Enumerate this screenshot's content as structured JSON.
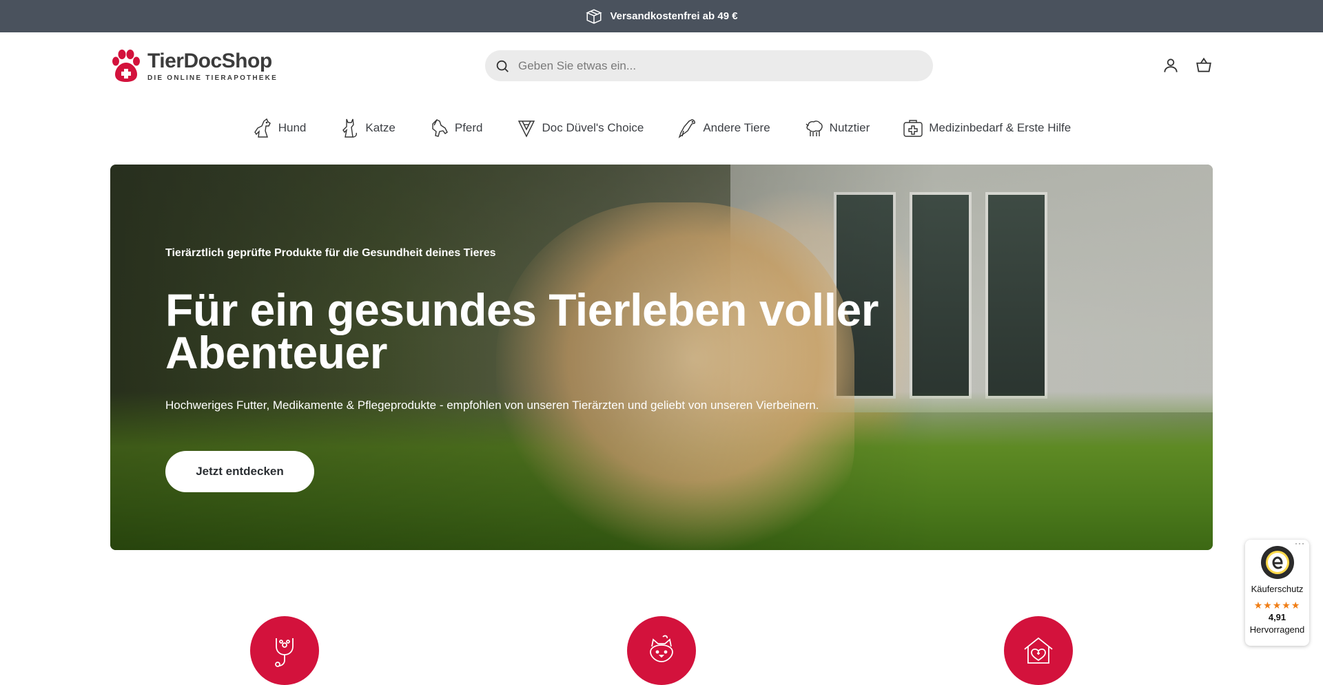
{
  "announcement": {
    "text": "Versandkostenfrei ab 49 €"
  },
  "header": {
    "logo_name": "TierDocShop",
    "logo_tagline": "DIE ONLINE TIERAPOTHEKE",
    "search_placeholder": "Geben Sie etwas ein..."
  },
  "nav": {
    "items": [
      {
        "label": "Hund",
        "icon": "dog-icon"
      },
      {
        "label": "Katze",
        "icon": "cat-icon"
      },
      {
        "label": "Pferd",
        "icon": "horse-icon"
      },
      {
        "label": "Doc Düvel's Choice",
        "icon": "badge-icon"
      },
      {
        "label": "Andere Tiere",
        "icon": "bird-icon"
      },
      {
        "label": "Nutztier",
        "icon": "sheep-icon"
      },
      {
        "label": "Medizinbedarf & Erste Hilfe",
        "icon": "first-aid-kit-icon"
      }
    ]
  },
  "hero": {
    "kicker": "Tierärztlich geprüfte Produkte für die Gesundheit deines Tieres",
    "title": "Für ein gesundes Tierleben voller Abenteuer",
    "subtitle": "Hochweriges Futter, Medikamente & Pflegeprodukte - empfohlen von unseren Tierärzten und geliebt von unseren Vierbeinern.",
    "cta": "Jetzt entdecken"
  },
  "features": [
    {
      "icon": "stethoscope-icon"
    },
    {
      "icon": "cat-face-icon"
    },
    {
      "icon": "pet-home-icon"
    }
  ],
  "trust_badge": {
    "more": "···",
    "label": "Käuferschutz",
    "stars": "★★★★★",
    "score": "4,91",
    "rating": "Hervorragend"
  },
  "colors": {
    "brand_red": "#d3123c",
    "announcement_bg": "#4a525d",
    "star": "#f07e16"
  }
}
